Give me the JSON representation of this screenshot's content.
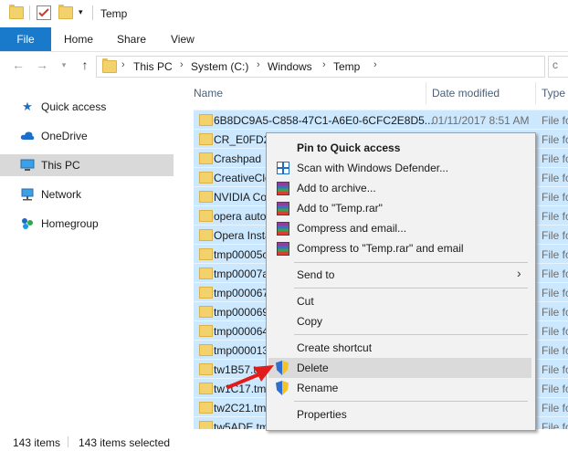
{
  "window": {
    "title": "Temp"
  },
  "ribbon": {
    "tabs": [
      "File",
      "Home",
      "Share",
      "View"
    ],
    "accent": "#1979ca"
  },
  "address": {
    "crumbs": [
      "This PC",
      "System (C:)",
      "Windows",
      "Temp"
    ]
  },
  "nav": {
    "items": [
      {
        "label": "Quick access",
        "icon": "star-icon"
      },
      {
        "label": "OneDrive",
        "icon": "cloud-icon"
      },
      {
        "label": "This PC",
        "icon": "computer-icon",
        "selected": true
      },
      {
        "label": "Network",
        "icon": "network-icon"
      },
      {
        "label": "Homegroup",
        "icon": "homegroup-icon"
      }
    ]
  },
  "list": {
    "columns": {
      "name": "Name",
      "date": "Date modified",
      "type": "Type"
    },
    "rows": [
      {
        "name": "6B8DC9A5-C858-47C1-A6E0-6CFC2E8D5...",
        "date": "01/11/2017 8:51 AM",
        "type": "File fo"
      },
      {
        "name": "CR_E0FD2.tmp",
        "date": "",
        "type": "File fo"
      },
      {
        "name": "Crashpad",
        "date": "",
        "type": "File fo"
      },
      {
        "name": "CreativeCloud",
        "date": "",
        "type": "File fo"
      },
      {
        "name": "NVIDIA Corporation",
        "date": "",
        "type": "File fo"
      },
      {
        "name": "opera autoupdate",
        "date": "",
        "type": "File fo"
      },
      {
        "name": "Opera Installer",
        "date": "",
        "type": "File fo"
      },
      {
        "name": "tmp00005c",
        "date": "",
        "type": "File fo"
      },
      {
        "name": "tmp00007a",
        "date": "",
        "type": "File fo"
      },
      {
        "name": "tmp000067",
        "date": "",
        "type": "File fo"
      },
      {
        "name": "tmp000069",
        "date": "",
        "type": "File fo"
      },
      {
        "name": "tmp000064",
        "date": "",
        "type": "File fo"
      },
      {
        "name": "tmp000013",
        "date": "",
        "type": "File fo"
      },
      {
        "name": "tw1B57.tmp",
        "date": "",
        "type": "File fo"
      },
      {
        "name": "tw1C17.tmp",
        "date": "",
        "type": "File fo"
      },
      {
        "name": "tw2C21.tmp",
        "date": "",
        "type": "File fo"
      },
      {
        "name": "tw5ADE.tmp",
        "date": "",
        "type": "File fo"
      }
    ]
  },
  "status": {
    "items_count": "143 items",
    "selected_count": "143 items selected"
  },
  "context_menu": {
    "items": [
      {
        "label": "Pin to Quick access",
        "bold": true,
        "icon": ""
      },
      {
        "label": "Scan with Windows Defender...",
        "icon": "defender-icon"
      },
      {
        "label": "Add to archive...",
        "icon": "winrar-icon"
      },
      {
        "label": "Add to \"Temp.rar\"",
        "icon": "winrar-icon"
      },
      {
        "label": "Compress and email...",
        "icon": "winrar-icon"
      },
      {
        "label": "Compress to \"Temp.rar\" and email",
        "icon": "winrar-icon"
      },
      {
        "label": "Send to",
        "icon": "",
        "submenu": true
      },
      {
        "label": "Cut",
        "icon": ""
      },
      {
        "label": "Copy",
        "icon": ""
      },
      {
        "label": "Create shortcut",
        "icon": ""
      },
      {
        "label": "Delete",
        "icon": "shield-icon",
        "hover": true
      },
      {
        "label": "Rename",
        "icon": "shield-icon"
      },
      {
        "label": "Properties",
        "icon": ""
      }
    ]
  },
  "colors": {
    "selection": "#cce8ff",
    "menu_bg": "#f2f2f2",
    "arrow": "#e21b1b"
  }
}
